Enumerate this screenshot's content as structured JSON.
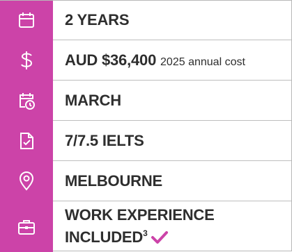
{
  "accent_color": "#cc43a8",
  "rows": [
    {
      "icon": "calendar-icon",
      "label": "2 YEARS"
    },
    {
      "icon": "dollar-icon",
      "label": "AUD $36,400",
      "note": "2025 annual cost"
    },
    {
      "icon": "calendar-clock-icon",
      "label": "MARCH"
    },
    {
      "icon": "document-check-icon",
      "label": "7/7.5 IELTS"
    },
    {
      "icon": "location-pin-icon",
      "label": "MELBOURNE"
    },
    {
      "icon": "briefcase-icon",
      "line1": "WORK EXPERIENCE",
      "line2": "INCLUDED",
      "footnote": "3",
      "check_icon": "checkmark-icon"
    }
  ]
}
